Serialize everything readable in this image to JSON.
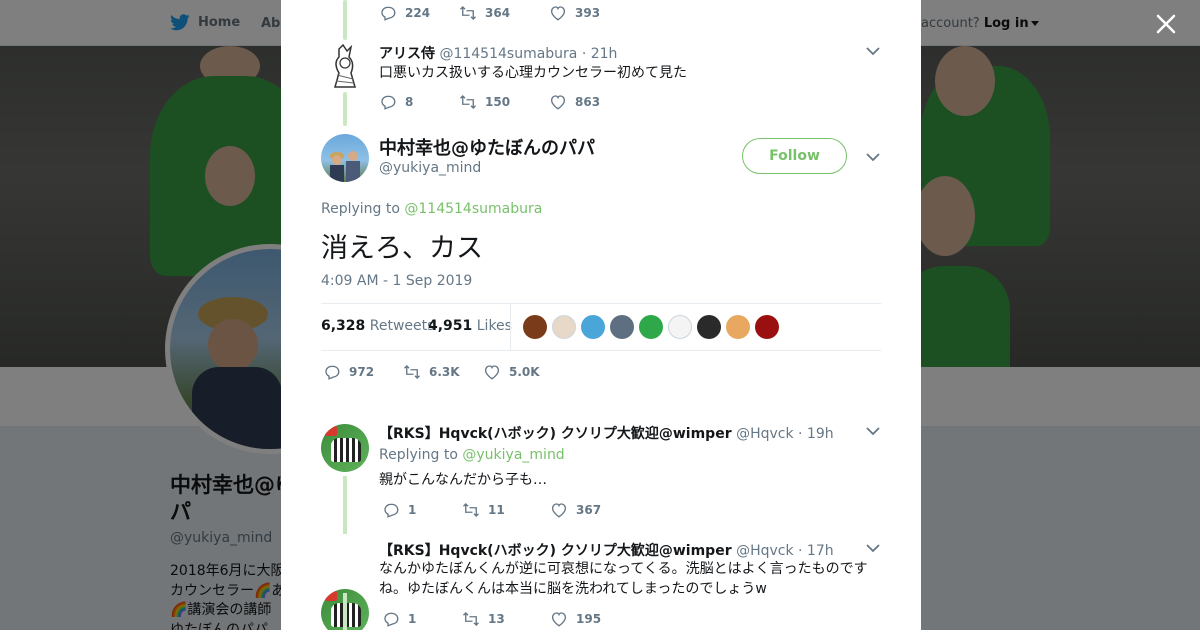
{
  "topbar": {
    "home_label": "Home",
    "about_label": "Abo",
    "account_prompt": "account?",
    "login_label": "Log in"
  },
  "profile": {
    "name": "中村幸也@ゆ\nパ",
    "handle": "@yukiya_mind",
    "bio_lines": [
      "2018年6月に大阪",
      "カウンセラー🌈あ",
      "🌈講演会の講師",
      "ゆたぼんのパパ"
    ]
  },
  "parent_tweet_actions": {
    "replies": "224",
    "retweets": "364",
    "likes": "393"
  },
  "parent_tweet": {
    "name": "アリス侍",
    "handle": "@114514sumabura",
    "time": "· 21h",
    "text": "口悪いカス扱いする心理カウンセラー初めて見た",
    "replies": "8",
    "retweets": "150",
    "likes": "863"
  },
  "main_tweet": {
    "name": "中村幸也@ゆたぼんのパパ",
    "handle": "@yukiya_mind",
    "follow_label": "Follow",
    "replying_prefix": "Replying to",
    "replying_to": "@114514sumabura",
    "text": "消えろ、カス",
    "timestamp": "4:09 AM - 1 Sep 2019",
    "retweets_count": "6,328",
    "retweets_label": "Retweets",
    "likes_count": "4,951",
    "likes_label": "Likes",
    "replies": "972",
    "retweets_short": "6.3K",
    "likes_short": "5.0K"
  },
  "replies": [
    {
      "name": "【RKS】Hqvck(ハボック) クソリプ大歓迎@wimper",
      "handle": "@Hqvck",
      "time": "· 19h",
      "replying_prefix": "Replying to",
      "replying_to": "@yukiya_mind",
      "text": "親がこんなんだから子も…",
      "replies": "1",
      "retweets": "11",
      "likes": "367"
    },
    {
      "name": "【RKS】Hqvck(ハボック) クソリプ大歓迎@wimper",
      "handle": "@Hqvck",
      "time": "· 17h",
      "text_lines": [
        "なんかゆたぼんくんが逆に可哀想になってくる。洗脳とはよく言ったものです",
        "ね。ゆたぼんくんは本当に脳を洗われてしまったのでしょうw"
      ],
      "replies": "1",
      "retweets": "13",
      "likes": "195"
    }
  ],
  "liker_colors": [
    "#7a3b1a",
    "#e8d8c8",
    "#4aa6d8",
    "#5d6f80",
    "#2fa84a",
    "#f4f4f4",
    "#2a2a2a",
    "#e8a860",
    "#9a1010"
  ],
  "colors": {
    "accent": "#78c16a",
    "secondary_text": "#657786"
  }
}
